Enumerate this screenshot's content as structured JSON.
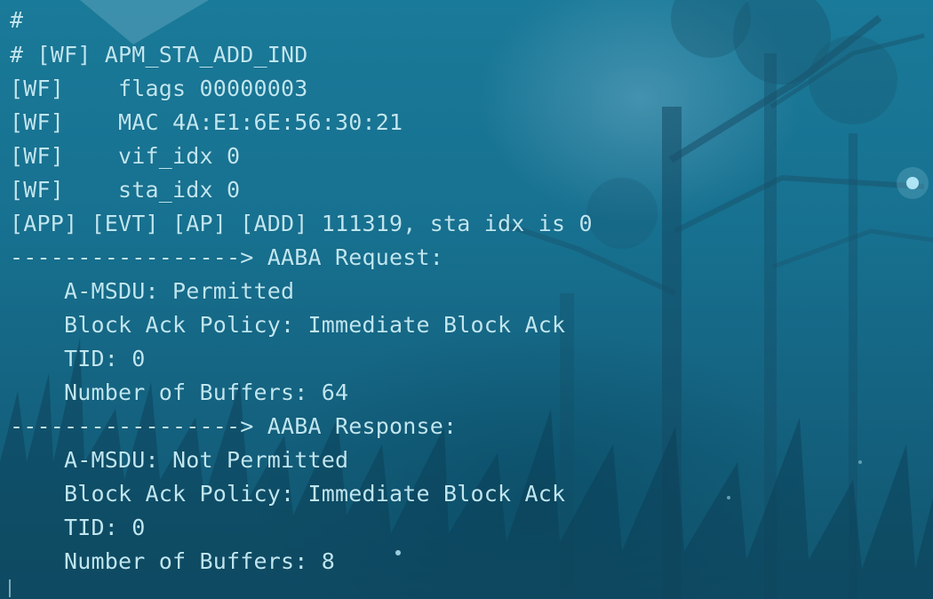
{
  "terminal": {
    "lines": [
      "#",
      "# [WF] APM_STA_ADD_IND",
      "[WF]    flags 00000003",
      "[WF]    MAC 4A:E1:6E:56:30:21",
      "[WF]    vif_idx 0",
      "[WF]    sta_idx 0",
      "[APP] [EVT] [AP] [ADD] 111319, sta idx is 0",
      "-----------------> AABA Request:",
      "    A-MSDU: Permitted",
      "    Block Ack Policy: Immediate Block Ack",
      "    TID: 0",
      "    Number of Buffers: 64",
      "-----------------> AABA Response:",
      "    A-MSDU: Not Permitted",
      "    Block Ack Policy: Immediate Block Ack",
      "    TID: 0",
      "    Number of Buffers: 8"
    ]
  },
  "colors": {
    "background": "#15708f",
    "text": "#bfe6f0"
  }
}
